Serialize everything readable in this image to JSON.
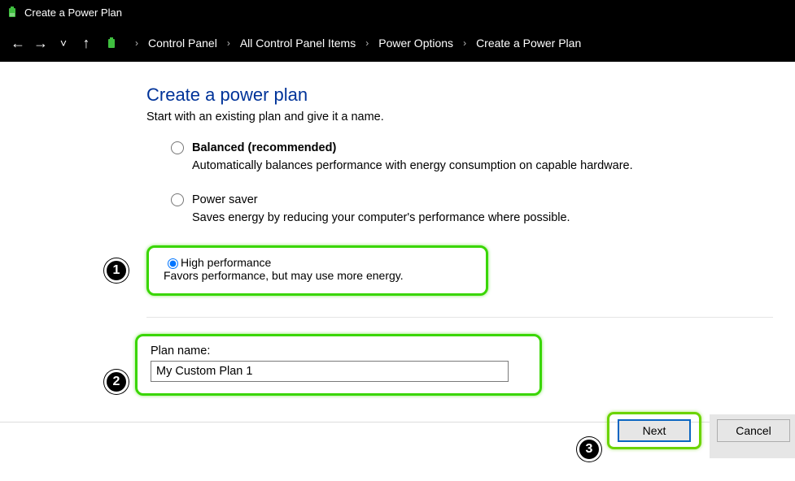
{
  "window": {
    "title": "Create a Power Plan"
  },
  "breadcrumb": {
    "items": [
      "Control Panel",
      "All Control Panel Items",
      "Power Options",
      "Create a Power Plan"
    ]
  },
  "page": {
    "heading": "Create a power plan",
    "subtitle": "Start with an existing plan and give it a name."
  },
  "plans": {
    "balanced": {
      "label": "Balanced (recommended)",
      "desc": "Automatically balances performance with energy consumption on capable hardware."
    },
    "saver": {
      "label": "Power saver",
      "desc": "Saves energy by reducing your computer's performance where possible."
    },
    "high": {
      "label": "High performance",
      "desc": "Favors performance, but may use more energy."
    }
  },
  "plan_name": {
    "label": "Plan name:",
    "value": "My Custom Plan 1"
  },
  "buttons": {
    "next": "Next",
    "cancel": "Cancel"
  },
  "annotations": {
    "a1": "1",
    "a2": "2",
    "a3": "3"
  }
}
